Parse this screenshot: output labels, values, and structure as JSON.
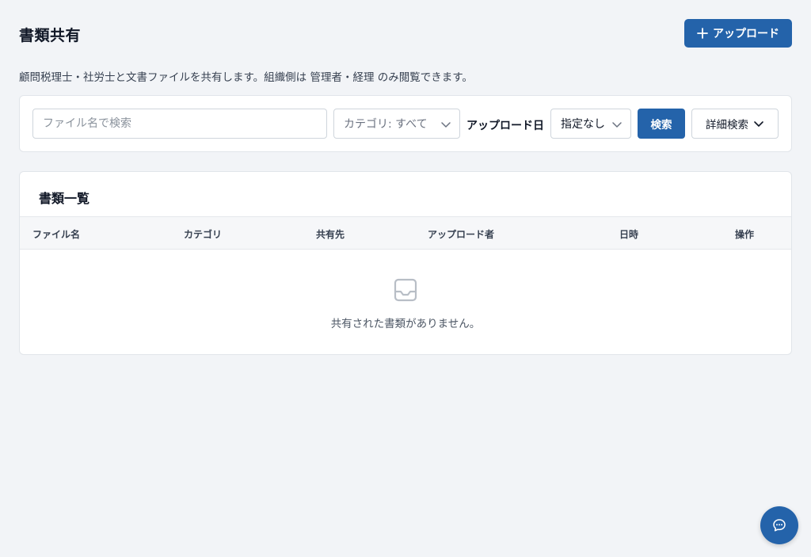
{
  "header": {
    "title": "書類共有",
    "upload_label": "アップロード"
  },
  "description": "顧問税理士・社労士と文書ファイルを共有します。組織側は 管理者・経理 のみ閲覧できます。",
  "filters": {
    "search_placeholder": "ファイル名で検索",
    "category_select": "カテゴリ: すべて",
    "upload_date_label": "アップロード日",
    "date_select": "指定なし",
    "search_button": "検索",
    "advanced_button": "詳細検索"
  },
  "list": {
    "title": "書類一覧",
    "columns": [
      "ファイル名",
      "カテゴリ",
      "共有先",
      "アップロード者",
      "日時",
      "操作"
    ],
    "rows": [],
    "empty_message": "共有された書類がありません。"
  },
  "icons": {
    "upload": "plus-icon",
    "select": "chevron-down-icon",
    "empty": "inbox-icon",
    "chat": "chat-icon"
  },
  "colors": {
    "primary": "#2463aa",
    "background": "#f2f4f7"
  }
}
